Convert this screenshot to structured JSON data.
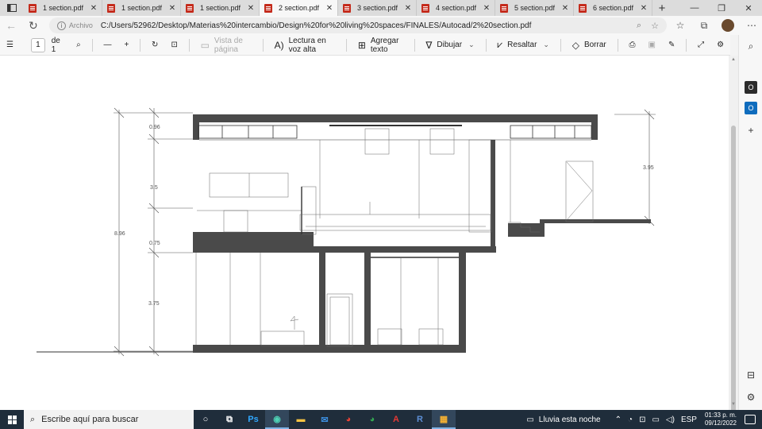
{
  "tabs": [
    {
      "label": "1 section.pdf",
      "active": false
    },
    {
      "label": "1 section.pdf",
      "active": false
    },
    {
      "label": "1 section.pdf",
      "active": false
    },
    {
      "label": "2 section.pdf",
      "active": true
    },
    {
      "label": "3 section.pdf",
      "active": false
    },
    {
      "label": "4 section.pdf",
      "active": false
    },
    {
      "label": "5 section.pdf",
      "active": false
    },
    {
      "label": "6 section.pdf",
      "active": false
    }
  ],
  "address": {
    "scheme": "Archivo",
    "url": "C:/Users/52962/Desktop/Materias%20intercambio/Design%20for%20living%20spaces/FINALES/Autocad/2%20section.pdf"
  },
  "pdf_toolbar": {
    "page_current": "1",
    "page_total": "de 1",
    "page_view": "Vista de página",
    "read_aloud": "Lectura en voz alta",
    "add_text": "Agregar texto",
    "draw": "Dibujar",
    "highlight": "Resaltar",
    "erase": "Borrar"
  },
  "drawing": {
    "dimensions": [
      "0.96",
      "3.5",
      "8.96",
      "0.75",
      "3.75",
      "3.95"
    ]
  },
  "taskbar": {
    "search_placeholder": "Escribe aquí para buscar",
    "weather": "Lluvia esta noche",
    "language": "ESP",
    "time": "01:33 p. m.",
    "date": "09/12/2022",
    "apps": [
      "task-view",
      "photoshop",
      "edge",
      "file-explorer",
      "mail",
      "chrome",
      "chrome",
      "acrobat",
      "r",
      "calculator"
    ]
  },
  "colors": {
    "wall": "#4a4a4a",
    "taskbar": "#1f2d3b",
    "pdf_accent": "#c42b1c"
  }
}
